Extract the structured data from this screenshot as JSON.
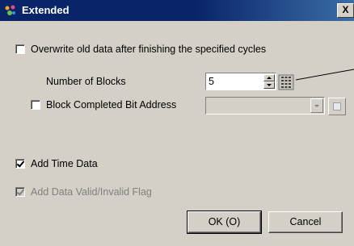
{
  "window": {
    "title": "Extended",
    "close_glyph": "X"
  },
  "options": {
    "overwrite": {
      "label": "Overwrite old data after finishing the specified cycles",
      "checked": false
    },
    "number_of_blocks": {
      "label": "Number of Blocks",
      "value": "5"
    },
    "block_completed": {
      "label": "Block Completed Bit Address",
      "checked": false,
      "address_value": ""
    },
    "add_time_data": {
      "label": "Add Time Data",
      "checked": true
    },
    "add_valid_flag": {
      "label": "Add Data Valid/Invalid Flag",
      "checked": true,
      "disabled": true
    }
  },
  "buttons": {
    "ok_label": "OK (O)",
    "cancel_label": "Cancel"
  },
  "icons": {
    "title": "extended-settings-icon",
    "calculator": "keypad-icon",
    "combo_side": "address-input-icon"
  },
  "colors": {
    "titlebar": "#0a246a",
    "dialog_bg": "#d4d0c8"
  }
}
